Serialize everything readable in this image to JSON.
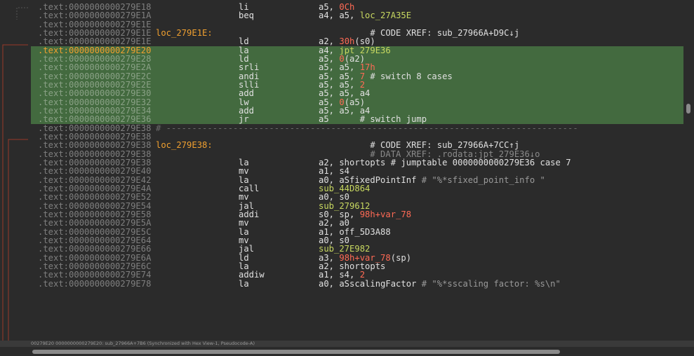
{
  "listing": {
    "rows": [
      {
        "addr": ".text:0000000000279E18",
        "label": "",
        "mn": "li",
        "ops": [
          {
            "t": "a5, "
          },
          {
            "t": "0Ch",
            "c": "num"
          }
        ]
      },
      {
        "addr": ".text:0000000000279E1A",
        "label": "",
        "mn": "beq",
        "ops": [
          {
            "t": "a4, a5, "
          },
          {
            "t": "loc_27A35E",
            "c": "ref"
          }
        ]
      },
      {
        "addr": ".text:0000000000279E1E",
        "label": "",
        "mn": "",
        "ops": []
      },
      {
        "addr": ".text:0000000000279E1E",
        "label": "loc_279E1E:",
        "mn": "",
        "ops": [
          {
            "t": "          # CODE XREF: sub_27966A+D9C↓j",
            "c": "cmt"
          }
        ]
      },
      {
        "addr": ".text:0000000000279E1E",
        "label": "",
        "mn": "ld",
        "ops": [
          {
            "t": "a2, "
          },
          {
            "t": "30h",
            "c": "num"
          },
          {
            "t": "(s0)"
          }
        ]
      },
      {
        "addr": ".text:0000000000279E20",
        "label": "",
        "mn": "la",
        "ops": [
          {
            "t": "a4, "
          },
          {
            "t": "jpt_279E36",
            "c": "ref"
          }
        ],
        "sel": true,
        "cur": true
      },
      {
        "addr": ".text:0000000000279E28",
        "label": "",
        "mn": "ld",
        "ops": [
          {
            "t": "a5, "
          },
          {
            "t": "0",
            "c": "num"
          },
          {
            "t": "(a2)"
          }
        ],
        "sel": true
      },
      {
        "addr": ".text:0000000000279E2A",
        "label": "",
        "mn": "srli",
        "ops": [
          {
            "t": "a5, a5, "
          },
          {
            "t": "17h",
            "c": "num"
          }
        ],
        "sel": true
      },
      {
        "addr": ".text:0000000000279E2C",
        "label": "",
        "mn": "andi",
        "ops": [
          {
            "t": "a5, a5, "
          },
          {
            "t": "7",
            "c": "num"
          },
          {
            "t": " # switch 8 cases",
            "c": "cmt"
          }
        ],
        "sel": true
      },
      {
        "addr": ".text:0000000000279E2E",
        "label": "",
        "mn": "slli",
        "ops": [
          {
            "t": "a5, a5, "
          },
          {
            "t": "2",
            "c": "num"
          }
        ],
        "sel": true
      },
      {
        "addr": ".text:0000000000279E30",
        "label": "",
        "mn": "add",
        "ops": [
          {
            "t": "a5, a5, a4"
          }
        ],
        "sel": true
      },
      {
        "addr": ".text:0000000000279E32",
        "label": "",
        "mn": "lw",
        "ops": [
          {
            "t": "a5, "
          },
          {
            "t": "0",
            "c": "num"
          },
          {
            "t": "(a5)"
          }
        ],
        "sel": true
      },
      {
        "addr": ".text:0000000000279E34",
        "label": "",
        "mn": "add",
        "ops": [
          {
            "t": "a5, a5, a4"
          }
        ],
        "sel": true
      },
      {
        "addr": ".text:0000000000279E36",
        "label": "",
        "mn": "jr",
        "ops": [
          {
            "t": "a5      "
          },
          {
            "t": "# switch jump",
            "c": "cmt"
          }
        ],
        "sel": true
      },
      {
        "addr": ".text:0000000000279E38",
        "label": "",
        "mn": "",
        "ops": [],
        "sep": "# --------------------------------------------------------------------------------"
      },
      {
        "addr": ".text:0000000000279E38",
        "label": "",
        "mn": "",
        "ops": []
      },
      {
        "addr": ".text:0000000000279E38",
        "label": "loc_279E38:",
        "mn": "",
        "ops": [
          {
            "t": "          # CODE XREF: sub_27966A+7CC↑j",
            "c": "cmt"
          }
        ]
      },
      {
        "addr": ".text:0000000000279E38",
        "label": "",
        "mn": "",
        "ops": [
          {
            "t": "          # DATA XREF: .rodata:jpt_279E36↓o",
            "c": "cmt-dim"
          }
        ]
      },
      {
        "addr": ".text:0000000000279E38",
        "label": "",
        "mn": "la",
        "ops": [
          {
            "t": "a2, shortopts # jumptable 0000000000279E36 case 7"
          }
        ]
      },
      {
        "addr": ".text:0000000000279E40",
        "label": "",
        "mn": "mv",
        "ops": [
          {
            "t": "a1, s4"
          }
        ]
      },
      {
        "addr": ".text:0000000000279E42",
        "label": "",
        "mn": "la",
        "ops": [
          {
            "t": "a0, aSfixedPointInf "
          },
          {
            "t": "# \"%*sfixed_point_info \"",
            "c": "str"
          }
        ]
      },
      {
        "addr": ".text:0000000000279E4A",
        "label": "",
        "mn": "call",
        "ops": [
          {
            "t": "sub_44D864",
            "c": "ref"
          }
        ]
      },
      {
        "addr": ".text:0000000000279E52",
        "label": "",
        "mn": "mv",
        "ops": [
          {
            "t": "a0, s0"
          }
        ]
      },
      {
        "addr": ".text:0000000000279E54",
        "label": "",
        "mn": "jal",
        "ops": [
          {
            "t": "sub_279612",
            "c": "ref"
          }
        ]
      },
      {
        "addr": ".text:0000000000279E58",
        "label": "",
        "mn": "addi",
        "ops": [
          {
            "t": "s0, sp, "
          },
          {
            "t": "98h+var_78",
            "c": "num"
          }
        ]
      },
      {
        "addr": ".text:0000000000279E5A",
        "label": "",
        "mn": "mv",
        "ops": [
          {
            "t": "a2, a0"
          }
        ]
      },
      {
        "addr": ".text:0000000000279E5C",
        "label": "",
        "mn": "la",
        "ops": [
          {
            "t": "a1, off_5D3A88"
          }
        ]
      },
      {
        "addr": ".text:0000000000279E64",
        "label": "",
        "mn": "mv",
        "ops": [
          {
            "t": "a0, s0"
          }
        ]
      },
      {
        "addr": ".text:0000000000279E66",
        "label": "",
        "mn": "jal",
        "ops": [
          {
            "t": "sub_27E982",
            "c": "ref"
          }
        ]
      },
      {
        "addr": ".text:0000000000279E6A",
        "label": "",
        "mn": "ld",
        "ops": [
          {
            "t": "a3, "
          },
          {
            "t": "98h+var_78",
            "c": "num"
          },
          {
            "t": "(sp)"
          }
        ]
      },
      {
        "addr": ".text:0000000000279E6C",
        "label": "",
        "mn": "la",
        "ops": [
          {
            "t": "a2, shortopts"
          }
        ]
      },
      {
        "addr": ".text:0000000000279E74",
        "label": "",
        "mn": "addiw",
        "ops": [
          {
            "t": "a1, s4, "
          },
          {
            "t": "2",
            "c": "num"
          }
        ]
      },
      {
        "addr": ".text:0000000000279E78",
        "label": "",
        "mn": "la",
        "ops": [
          {
            "t": "a0, aSscalingFactor "
          },
          {
            "t": "# \"%*sscaling factor: %s\\n\"",
            "c": "str"
          }
        ]
      }
    ]
  },
  "status": {
    "text": "00279E20 0000000000279E20: sub_27966A+7B6 (Synchronized with Hex View-1, Pseudocode-A)"
  }
}
